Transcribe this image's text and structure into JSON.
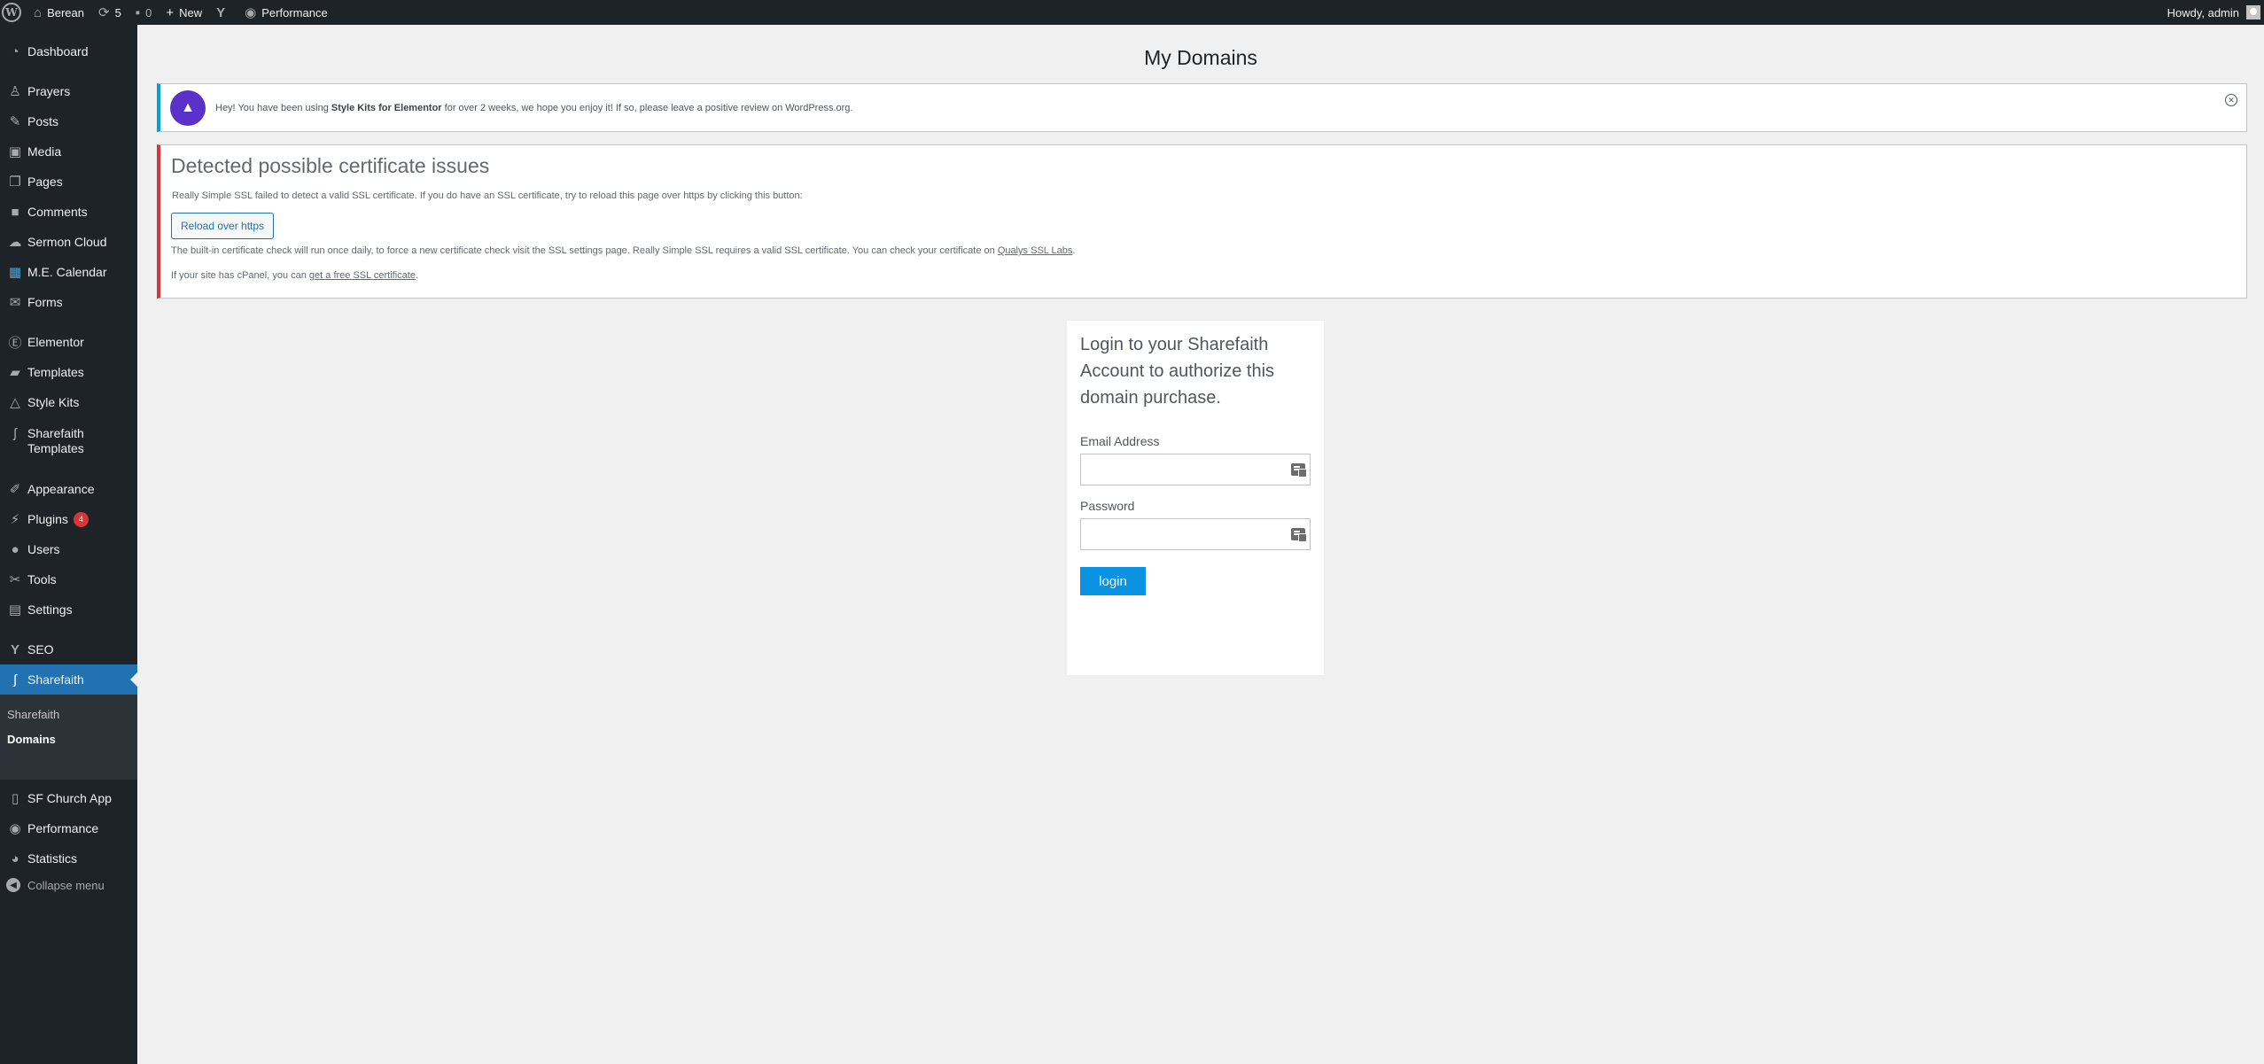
{
  "adminbar": {
    "site_name": "Berean",
    "updates_count": "5",
    "comments_count": "0",
    "new_label": "New",
    "performance_label": "Performance",
    "howdy": "Howdy, admin"
  },
  "sidebar": {
    "items": [
      {
        "label": "Dashboard"
      },
      {
        "label": "Prayers"
      },
      {
        "label": "Posts"
      },
      {
        "label": "Media"
      },
      {
        "label": "Pages"
      },
      {
        "label": "Comments"
      },
      {
        "label": "Sermon Cloud"
      },
      {
        "label": "M.E. Calendar"
      },
      {
        "label": "Forms"
      },
      {
        "label": "Elementor"
      },
      {
        "label": "Templates"
      },
      {
        "label": "Style Kits"
      },
      {
        "label": "Sharefaith Templates"
      },
      {
        "label": "Appearance"
      },
      {
        "label": "Plugins",
        "badge": "4"
      },
      {
        "label": "Users"
      },
      {
        "label": "Tools"
      },
      {
        "label": "Settings"
      },
      {
        "label": "SEO"
      },
      {
        "label": "Sharefaith"
      },
      {
        "label": "SF Church App"
      },
      {
        "label": "Performance"
      },
      {
        "label": "Statistics"
      }
    ],
    "submenu": [
      {
        "label": "Sharefaith"
      },
      {
        "label": "Domains"
      }
    ],
    "collapse_label": "Collapse menu"
  },
  "page": {
    "title": "My Domains"
  },
  "notice_stylekits": {
    "text_before": "Hey! You have been using ",
    "text_bold": "Style Kits for Elementor",
    "text_after": " for over 2 weeks, we hope you enjoy it! If so, please leave a positive review on WordPress.org."
  },
  "notice_ssl": {
    "title": "Detected possible certificate issues",
    "p1": "Really Simple SSL failed to detect a valid SSL certificate. If you do have an SSL certificate, try to reload this page over https by clicking this button:",
    "button": "Reload over https",
    "p2_before": "The built-in certificate check will run once daily, to force a new certificate check visit the SSL settings page. Really Simple SSL requires a valid SSL certificate. You can check your certificate on ",
    "p2_link": "Qualys SSL Labs",
    "p2_after": ".",
    "p3_before": "If your site has cPanel, you can ",
    "p3_link": "get a free SSL certificate",
    "p3_after": "."
  },
  "login": {
    "heading": "Login to your Sharefaith Account to authorize this domain purchase.",
    "email_label": "Email Address",
    "email_value": "",
    "password_label": "Password",
    "password_value": "",
    "button": "login"
  }
}
